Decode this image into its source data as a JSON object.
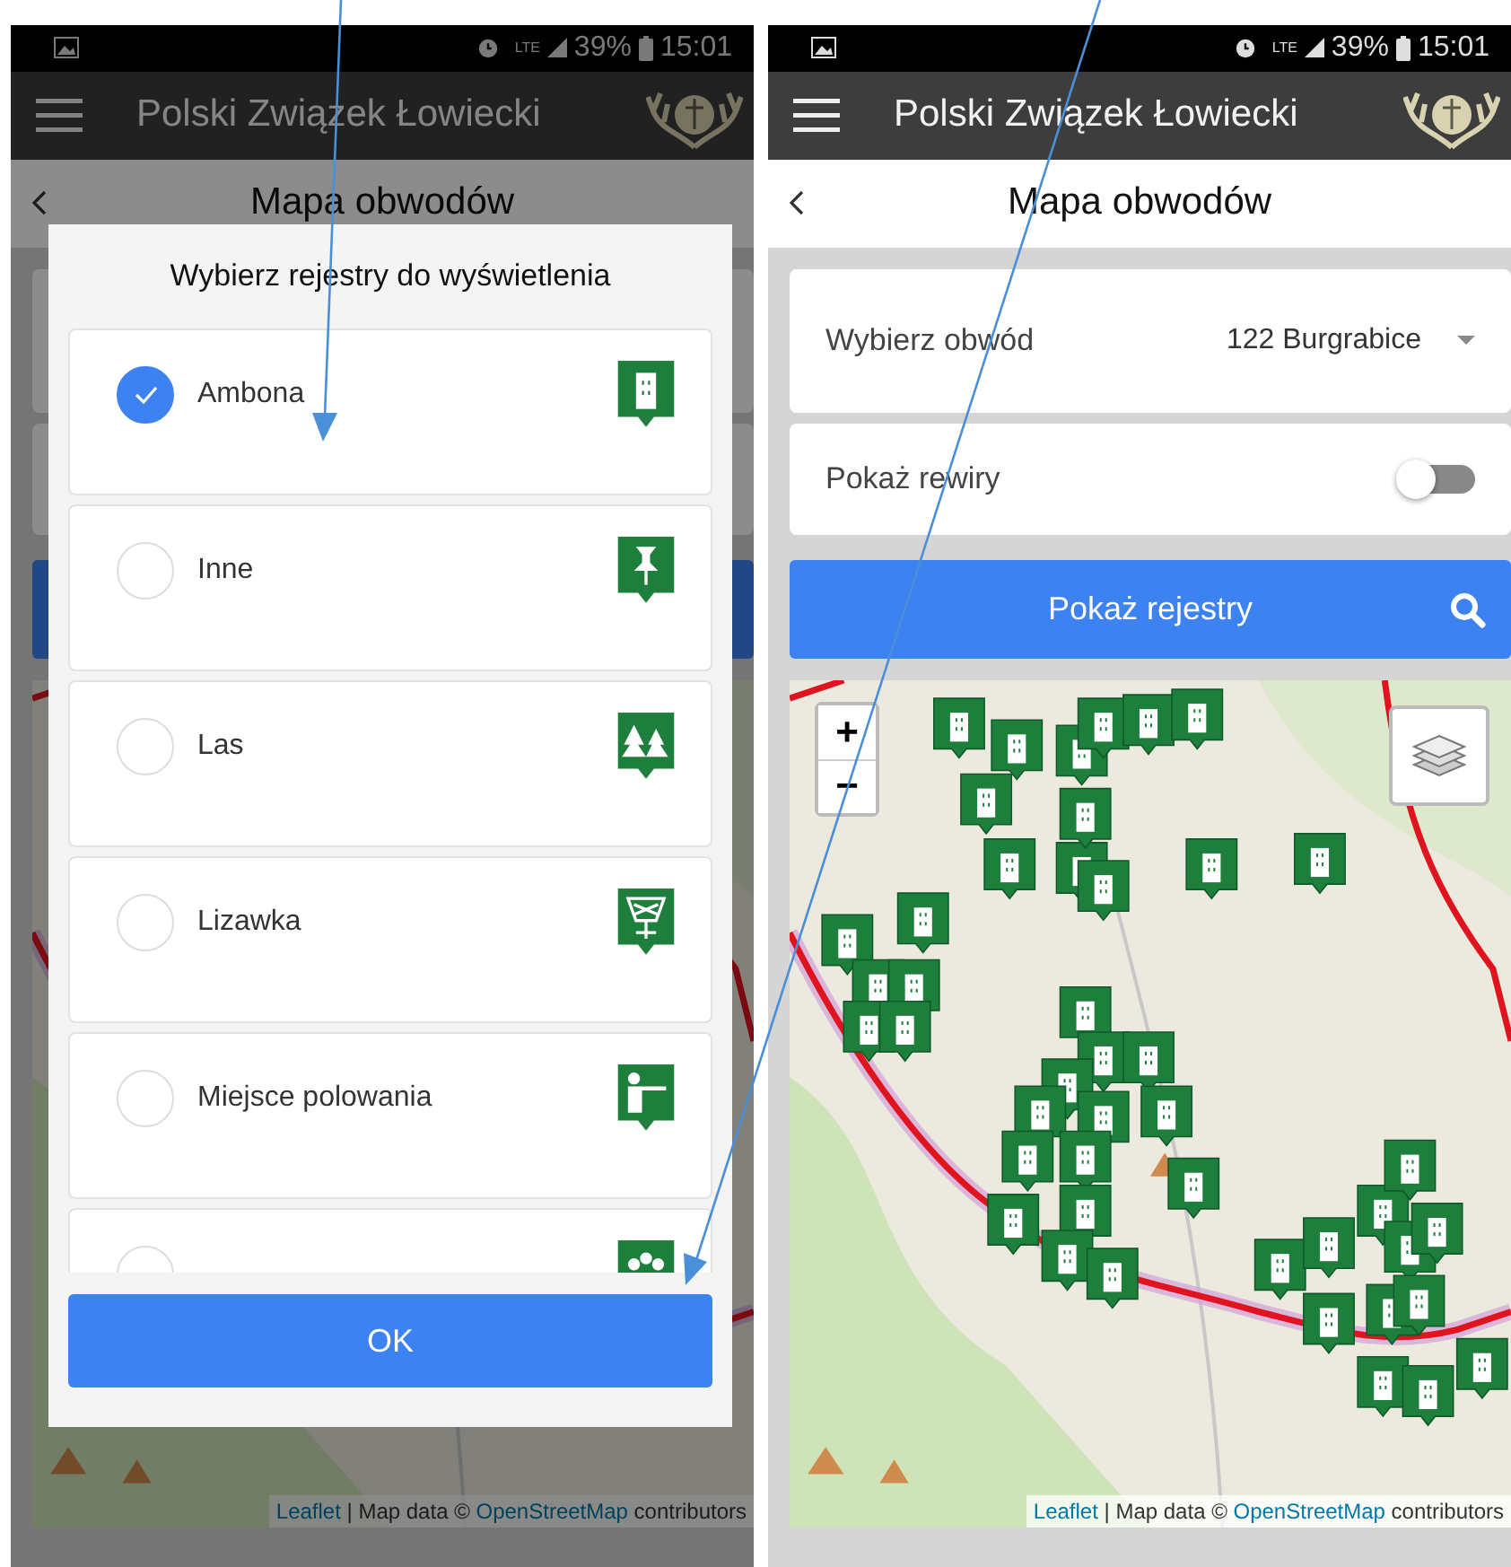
{
  "screens": [
    {
      "status_bar": {
        "network": "LTE",
        "battery": "39%",
        "time": "15:01"
      },
      "app_bar": {
        "title": "Polski Związek Łowiecki"
      },
      "header": {
        "title": "Mapa obwodów"
      },
      "dialog": {
        "title": "Wybierz rejestry do wyświetlenia",
        "options": [
          {
            "label": "Ambona",
            "checked": true,
            "kind": "tower"
          },
          {
            "label": "Inne",
            "checked": false,
            "kind": "pin"
          },
          {
            "label": "Las",
            "checked": false,
            "kind": "trees"
          },
          {
            "label": "Lizawka",
            "checked": false,
            "kind": "feeder"
          },
          {
            "label": "Miejsce polowania",
            "checked": false,
            "kind": "hunter"
          },
          {
            "checked": false,
            "kind": "group"
          }
        ],
        "ok_button": "OK"
      },
      "map": {
        "attribution": {
          "leaflet": "Leaflet",
          "middle": "| Map data ©",
          "osm": "OpenStreetMap",
          "suffix": "contributors"
        }
      }
    },
    {
      "status_bar": {
        "network": "LTE",
        "battery": "39%",
        "time": "15:01"
      },
      "app_bar": {
        "title": "Polski Związek Łowiecki"
      },
      "header": {
        "title": "Mapa obwodów"
      },
      "form": {
        "select": {
          "label": "Wybierz obwód",
          "value": "122 Burgrabice"
        },
        "toggle": {
          "label": "Pokaż rewiry",
          "on": false
        },
        "button": "Pokaż rejestry"
      },
      "map": {
        "zoom_in": "+",
        "zoom_out": "−",
        "attribution": {
          "leaflet": "Leaflet",
          "middle": "| Map data ©",
          "osm": "OpenStreetMap",
          "suffix": "contributors"
        }
      }
    }
  ]
}
